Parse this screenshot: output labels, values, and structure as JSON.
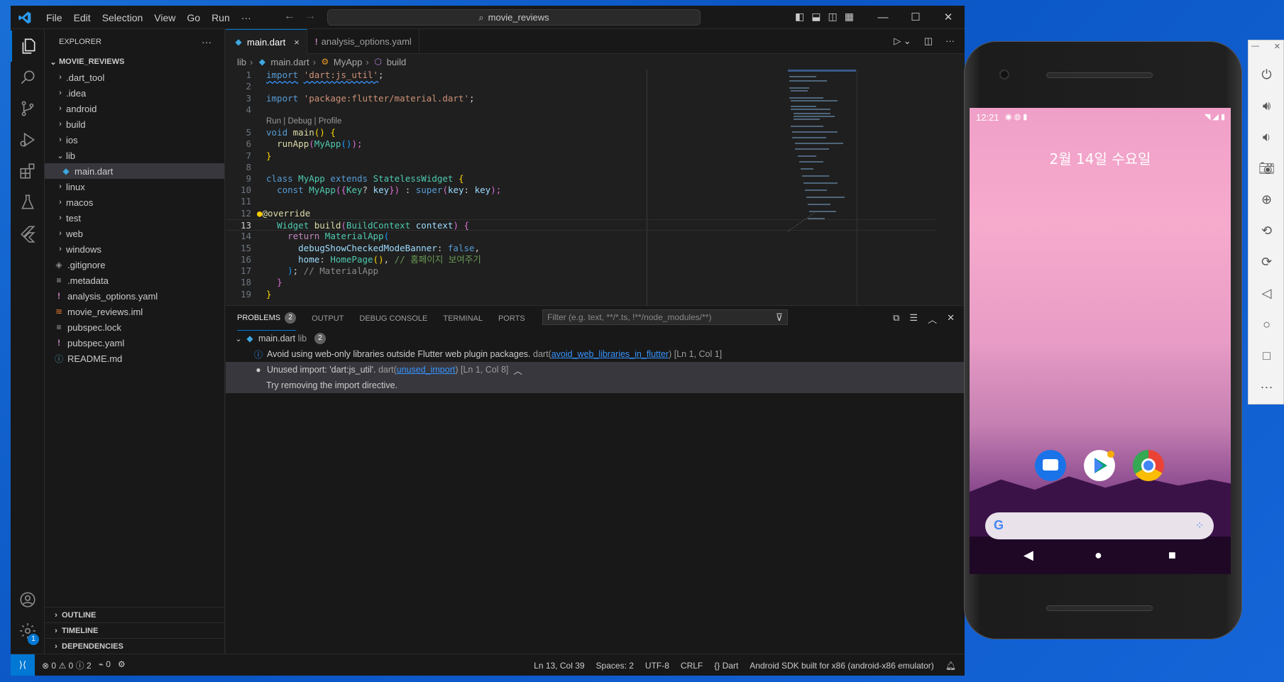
{
  "menu": {
    "file": "File",
    "edit": "Edit",
    "selection": "Selection",
    "view": "View",
    "go": "Go",
    "run": "Run",
    "more": "···"
  },
  "command_center": "movie_reviews",
  "sidebar": {
    "title": "EXPLORER",
    "more": "···",
    "root": "MOVIE_REVIEWS",
    "items": [
      ".dart_tool",
      ".idea",
      "android",
      "build",
      "ios",
      "lib",
      "main.dart",
      "linux",
      "macos",
      "test",
      "web",
      "windows",
      ".gitignore",
      ".metadata",
      "analysis_options.yaml",
      "movie_reviews.iml",
      "pubspec.lock",
      "pubspec.yaml",
      "README.md"
    ],
    "sections": [
      "OUTLINE",
      "TIMELINE",
      "DEPENDENCIES"
    ]
  },
  "tabs": [
    {
      "label": "main.dart",
      "close": "×"
    },
    {
      "label": "analysis_options.yaml"
    }
  ],
  "breadcrumb": [
    "lib",
    "main.dart",
    "MyApp",
    "build"
  ],
  "code": {
    "l1a": "import",
    "l1b": "'dart:js_util'",
    "l1c": ";",
    "l3a": "import",
    "l3b": "'package:flutter/material.dart'",
    "l3c": ";",
    "codelens": "Run | Debug | Profile",
    "l5a": "void",
    "l5b": "main",
    "l5c": "()",
    "l5d": " {",
    "l6a": "runApp",
    "l6b": "(",
    "l6c": "MyApp",
    "l6d": "()",
    "l6e": ");",
    "l7": "}",
    "l9a": "class",
    "l9b": "MyApp",
    "l9c": "extends",
    "l9d": "StatelessWidget",
    "l9e": " {",
    "l10a": "const",
    "l10b": "MyApp",
    "l10c": "({",
    "l10d": "Key",
    "l10e": "? ",
    "l10f": "key",
    "l10g": "})",
    "l10h": " : ",
    "l10i": "super",
    "l10j": "(",
    "l10k": "key",
    "l10l": ": ",
    "l10m": "key",
    "l10n": ");",
    "l12": "@override",
    "l13a": "Widget",
    "l13b": "build",
    "l13c": "(",
    "l13d": "BuildContext",
    "l13e": "context",
    "l13f": ")",
    "l13g": " {",
    "l14a": "return",
    "l14b": "MaterialApp",
    "l14c": "(",
    "l15a": "debugShowCheckedModeBanner",
    "l15b": ": ",
    "l15c": "false",
    "l15d": ",",
    "l16a": "home",
    "l16b": ": ",
    "l16c": "HomePage",
    "l16d": "()",
    "l16e": ", ",
    "l16f": "// 홈페이지 보여주기",
    "l17a": ")",
    "l17b": "; ",
    "l17c": "// MaterialApp",
    "l18": "}",
    "l19": "}"
  },
  "line_numbers": [
    "1",
    "2",
    "3",
    "4",
    "5",
    "6",
    "7",
    "8",
    "9",
    "10",
    "11",
    "12",
    "13",
    "14",
    "15",
    "16",
    "17",
    "18",
    "19"
  ],
  "panel": {
    "tabs": [
      "PROBLEMS",
      "OUTPUT",
      "DEBUG CONSOLE",
      "TERMINAL",
      "PORTS"
    ],
    "problem_count": "2",
    "filter_placeholder": "Filter (e.g. text, **/*.ts, !**/node_modules/**)",
    "file": "main.dart",
    "file_dir": "lib",
    "file_count": "2",
    "p1_msg": "Avoid using web-only libraries outside Flutter web plugin packages.",
    "p1_src": "dart(",
    "p1_link": "avoid_web_libraries_in_flutter",
    "p1_end": ")",
    "p1_pos": "[Ln 1, Col 1]",
    "p2_msg": "Unused import: 'dart:js_util'.",
    "p2_src": "dart(",
    "p2_link": "unused_import",
    "p2_end": ")",
    "p2_pos": "[Ln 1, Col 8]",
    "p2_hint": "Try removing the import directive."
  },
  "status": {
    "errors": "0",
    "warnings": "0",
    "infos": "2",
    "ports": "0",
    "position": "Ln 13, Col 39",
    "spaces": "Spaces: 2",
    "encoding": "UTF-8",
    "eol": "CRLF",
    "language": "Dart",
    "device": "Android SDK built for x86 (android-x86 emulator)",
    "settings_badge": "1"
  },
  "phone": {
    "time": "12:21",
    "date": "2월 14일 수요일"
  },
  "colors": {
    "accent": "#0078d4",
    "editor_bg": "#1f1f1f",
    "chrome_bg": "#181818",
    "desktop": "#1565d8"
  }
}
